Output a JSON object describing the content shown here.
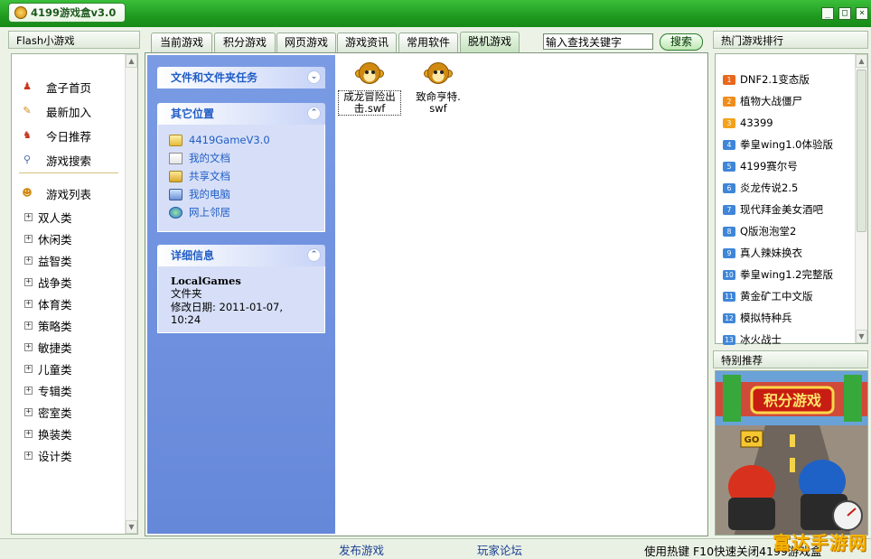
{
  "app": {
    "title": "4199游戏盒v3.0",
    "window_buttons": [
      "_",
      "□",
      "×"
    ]
  },
  "left": {
    "header": "Flash小游戏",
    "nav": [
      {
        "label": "盒子首页",
        "icon": "home-icon"
      },
      {
        "label": "最新加入",
        "icon": "new-icon"
      },
      {
        "label": "今日推荐",
        "icon": "recommend-icon"
      },
      {
        "label": "游戏搜索",
        "icon": "search-icon"
      }
    ],
    "list_title": "游戏列表",
    "categories": [
      "双人类",
      "休闲类",
      "益智类",
      "战争类",
      "体育类",
      "策略类",
      "敏捷类",
      "儿童类",
      "专辑类",
      "密室类",
      "换装类",
      "设计类"
    ]
  },
  "tabs": [
    {
      "label": "当前游戏"
    },
    {
      "label": "积分游戏"
    },
    {
      "label": "网页游戏"
    },
    {
      "label": "游戏资讯"
    },
    {
      "label": "常用软件"
    },
    {
      "label": "脱机游戏",
      "active": true
    }
  ],
  "search": {
    "value": "输入查找关键字",
    "button": "搜索"
  },
  "taskpane": {
    "tasks_title": "文件和文件夹任务",
    "places_title": "其它位置",
    "places": [
      {
        "label": "4419GameV3.0",
        "icon": "folder-icon"
      },
      {
        "label": "我的文档",
        "icon": "my-documents-icon"
      },
      {
        "label": "共享文档",
        "icon": "shared-documents-icon"
      },
      {
        "label": "我的电脑",
        "icon": "my-computer-icon"
      },
      {
        "label": "网上邻居",
        "icon": "network-places-icon"
      }
    ],
    "details_title": "详细信息",
    "details_name": "LocalGames",
    "details_type": "文件夹",
    "details_modified": "修改日期: 2011-01-07, 10:24"
  },
  "files": [
    {
      "name_line1": "成龙冒险出",
      "name_line2": "击.swf",
      "selected": true
    },
    {
      "name_line1": "致命亨特.",
      "name_line2": "swf",
      "selected": false
    }
  ],
  "rank": {
    "header": "热门游戏排行",
    "items": [
      {
        "n": "1",
        "label": "DNF2.1变态版",
        "color": "#e8681c"
      },
      {
        "n": "2",
        "label": "植物大战僵尸",
        "color": "#f08c1a"
      },
      {
        "n": "3",
        "label": "43399",
        "color": "#f2a21c"
      },
      {
        "n": "4",
        "label": "拳皇wing1.0体验版",
        "color": "#3f86d8"
      },
      {
        "n": "5",
        "label": "4199赛尔号",
        "color": "#3f86d8"
      },
      {
        "n": "6",
        "label": "炎龙传说2.5",
        "color": "#3f86d8"
      },
      {
        "n": "7",
        "label": "现代拜金美女酒吧",
        "color": "#3f86d8"
      },
      {
        "n": "8",
        "label": "Q版泡泡堂2",
        "color": "#3f86d8"
      },
      {
        "n": "9",
        "label": "真人辣妹换衣",
        "color": "#3f86d8"
      },
      {
        "n": "10",
        "label": "拳皇wing1.2完整版",
        "color": "#3f86d8"
      },
      {
        "n": "11",
        "label": "黄金矿工中文版",
        "color": "#3f86d8"
      },
      {
        "n": "12",
        "label": "模拟特种兵",
        "color": "#3f86d8"
      },
      {
        "n": "13",
        "label": "冰火战士",
        "color": "#3f86d8"
      }
    ]
  },
  "recommend": {
    "header": "特别推荐",
    "banner_text": "积分游戏",
    "go_text": "GO"
  },
  "status": {
    "publish": "发布游戏",
    "forum": "玩家论坛",
    "hint": "使用热键 F10快速关闭4199游戏盒",
    "watermark": "富达手游网"
  }
}
